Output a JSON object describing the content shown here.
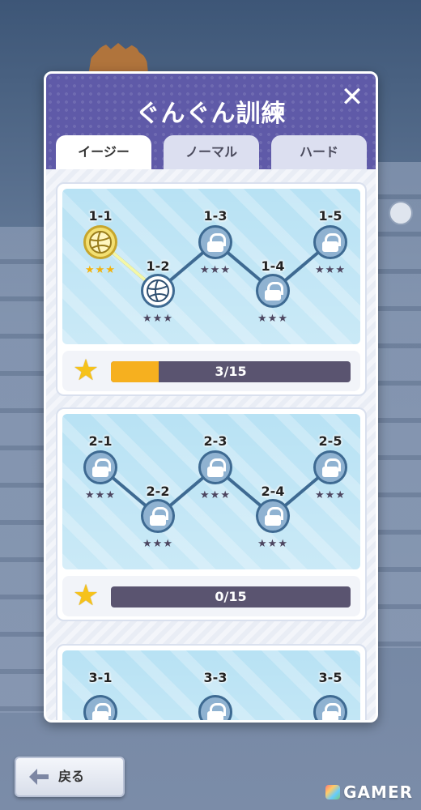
{
  "title": "ぐんぐん訓練",
  "tabs": [
    {
      "label": "イージー",
      "active": true
    },
    {
      "label": "ノーマル",
      "active": false
    },
    {
      "label": "ハード",
      "active": false
    }
  ],
  "chapters": [
    {
      "stages": [
        {
          "label": "1-1",
          "state": "cleared",
          "stars": 3
        },
        {
          "label": "1-2",
          "state": "current",
          "stars": 0
        },
        {
          "label": "1-3",
          "state": "locked",
          "stars": 0
        },
        {
          "label": "1-4",
          "state": "locked",
          "stars": 0
        },
        {
          "label": "1-5",
          "state": "locked",
          "stars": 0
        }
      ],
      "progress": {
        "text": "3/15",
        "value": 3,
        "max": 15
      }
    },
    {
      "stages": [
        {
          "label": "2-1",
          "state": "locked",
          "stars": 0
        },
        {
          "label": "2-2",
          "state": "locked",
          "stars": 0
        },
        {
          "label": "2-3",
          "state": "locked",
          "stars": 0
        },
        {
          "label": "2-4",
          "state": "locked",
          "stars": 0
        },
        {
          "label": "2-5",
          "state": "locked",
          "stars": 0
        }
      ],
      "progress": {
        "text": "0/15",
        "value": 0,
        "max": 15
      }
    },
    {
      "stages": [
        {
          "label": "3-1",
          "state": "locked",
          "stars": 0
        },
        {
          "label": "3-3",
          "state": "locked",
          "stars": 0
        },
        {
          "label": "3-5",
          "state": "locked",
          "stars": 0
        }
      ]
    }
  ],
  "back_label": "戻る",
  "watermark": "GAMER",
  "colors": {
    "header": "#5f5aa8",
    "progress_fill": "#f6b01f",
    "bar_bg": "#5a5470",
    "map_bg": "#b8e2f4"
  }
}
